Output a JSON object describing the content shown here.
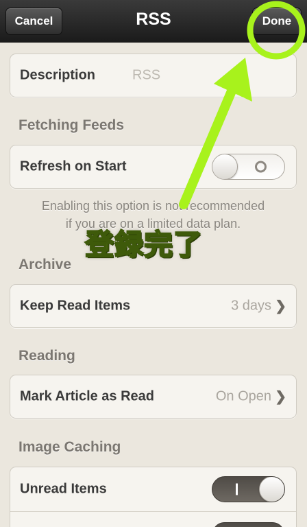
{
  "navbar": {
    "cancel_label": "Cancel",
    "title": "RSS",
    "done_label": "Done"
  },
  "description": {
    "label": "Description",
    "value": "RSS"
  },
  "sections": {
    "fetching": "Fetching Feeds",
    "archive": "Archive",
    "reading": "Reading",
    "image_caching": "Image Caching"
  },
  "refresh_on_start": {
    "label": "Refresh on Start",
    "state": "off"
  },
  "fetching_footnote": {
    "line1": "Enabling this option is not recommended",
    "line2": "if you are on a limited data plan."
  },
  "keep_read_items": {
    "label": "Keep Read Items",
    "value": "3 days"
  },
  "mark_article_as_read": {
    "label": "Mark Article as Read",
    "value": "On Open"
  },
  "unread_items": {
    "label": "Unread Items",
    "state": "on"
  },
  "annotation": {
    "caption": "登録完了",
    "color": "#b6f23a"
  },
  "colors": {
    "navbar": "#1b1b1b",
    "background": "#ebe7de",
    "annotation_green": "#a8f21c"
  }
}
